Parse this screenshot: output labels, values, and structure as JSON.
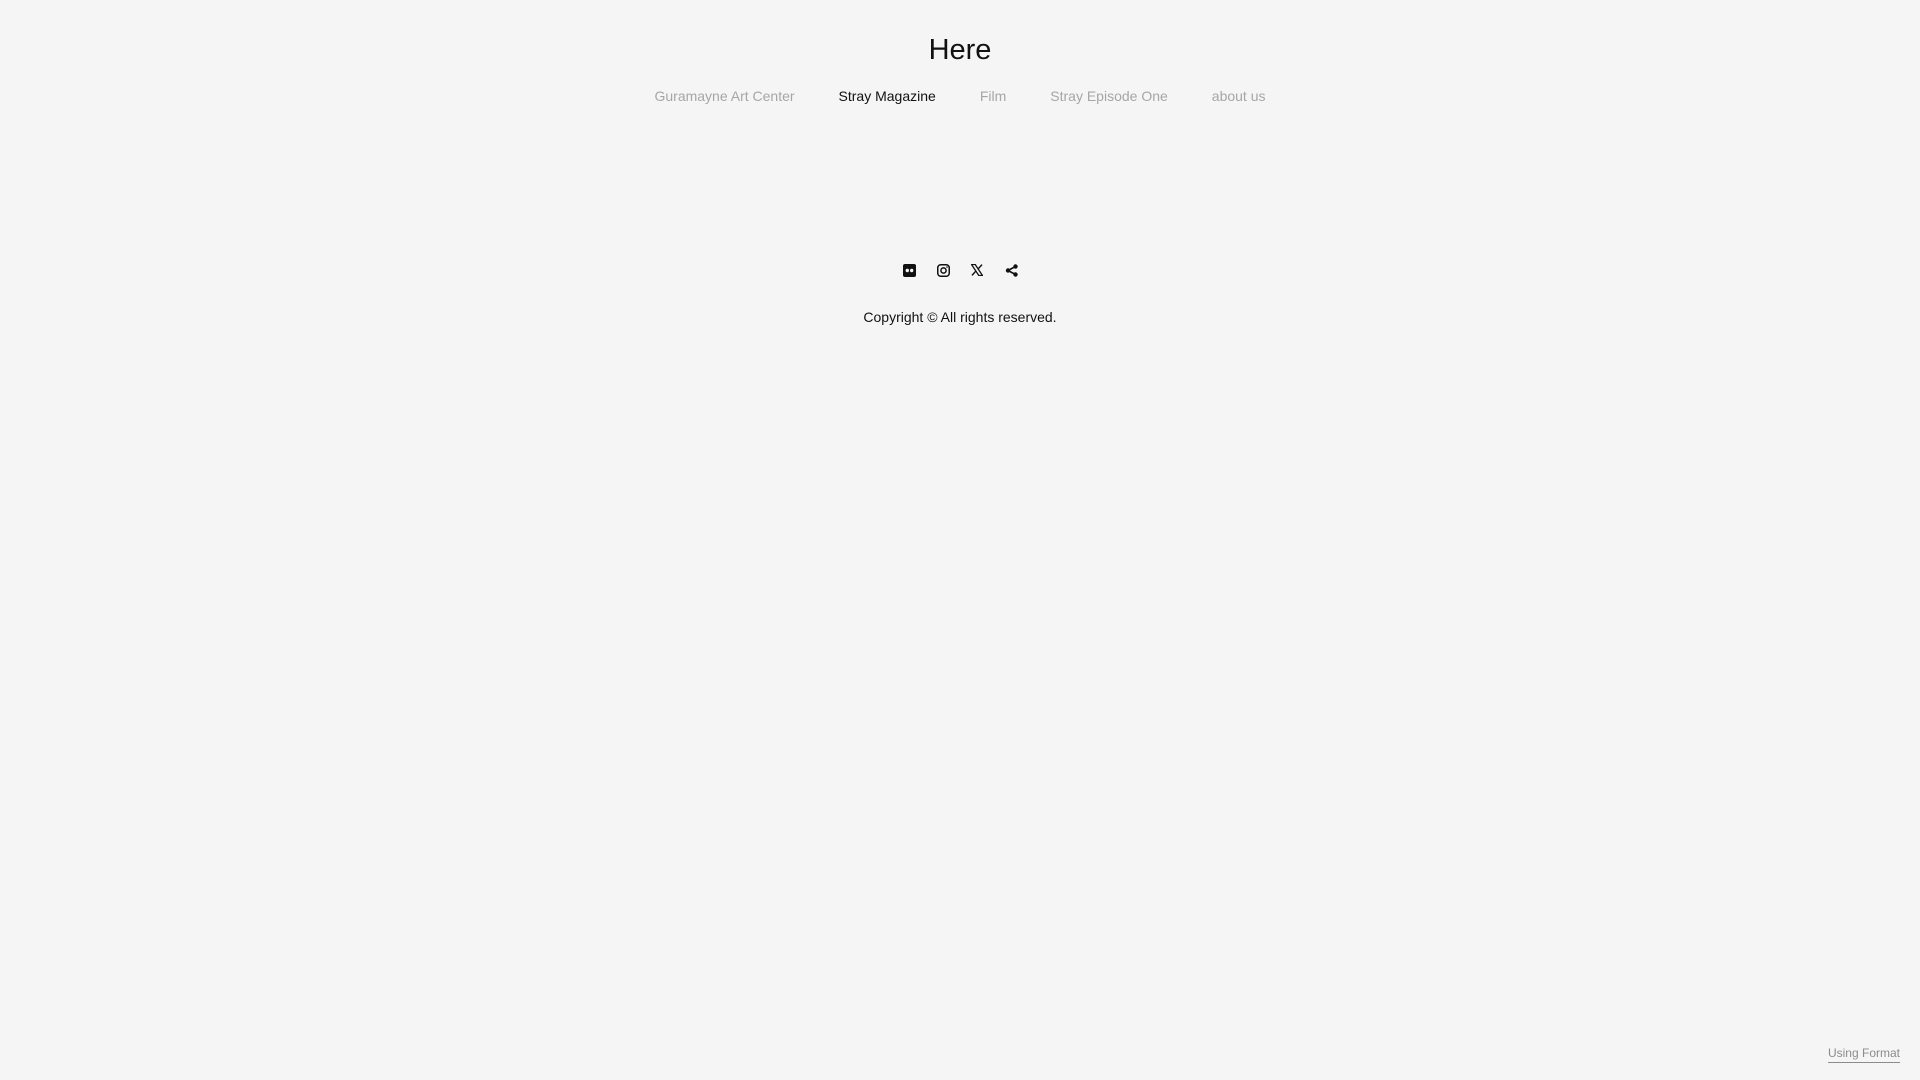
{
  "site": {
    "title": "Here"
  },
  "nav": {
    "items": [
      {
        "label": "Guramayne Art Center",
        "active": false
      },
      {
        "label": "Stray Magazine",
        "active": true
      },
      {
        "label": "Film",
        "active": false
      },
      {
        "label": "Stray Episode One",
        "active": false
      },
      {
        "label": "about us",
        "active": false
      }
    ]
  },
  "social": {
    "icons": [
      "flickr-icon",
      "instagram-icon",
      "x-icon",
      "share-icon"
    ]
  },
  "footer": {
    "copyright": "Copyright © All rights reserved.",
    "badge": "Using Format"
  },
  "colors": {
    "background": "#f5f5f5",
    "text": "#111111",
    "nav_inactive": "#a6a6a6",
    "badge": "#8c8c8c"
  }
}
